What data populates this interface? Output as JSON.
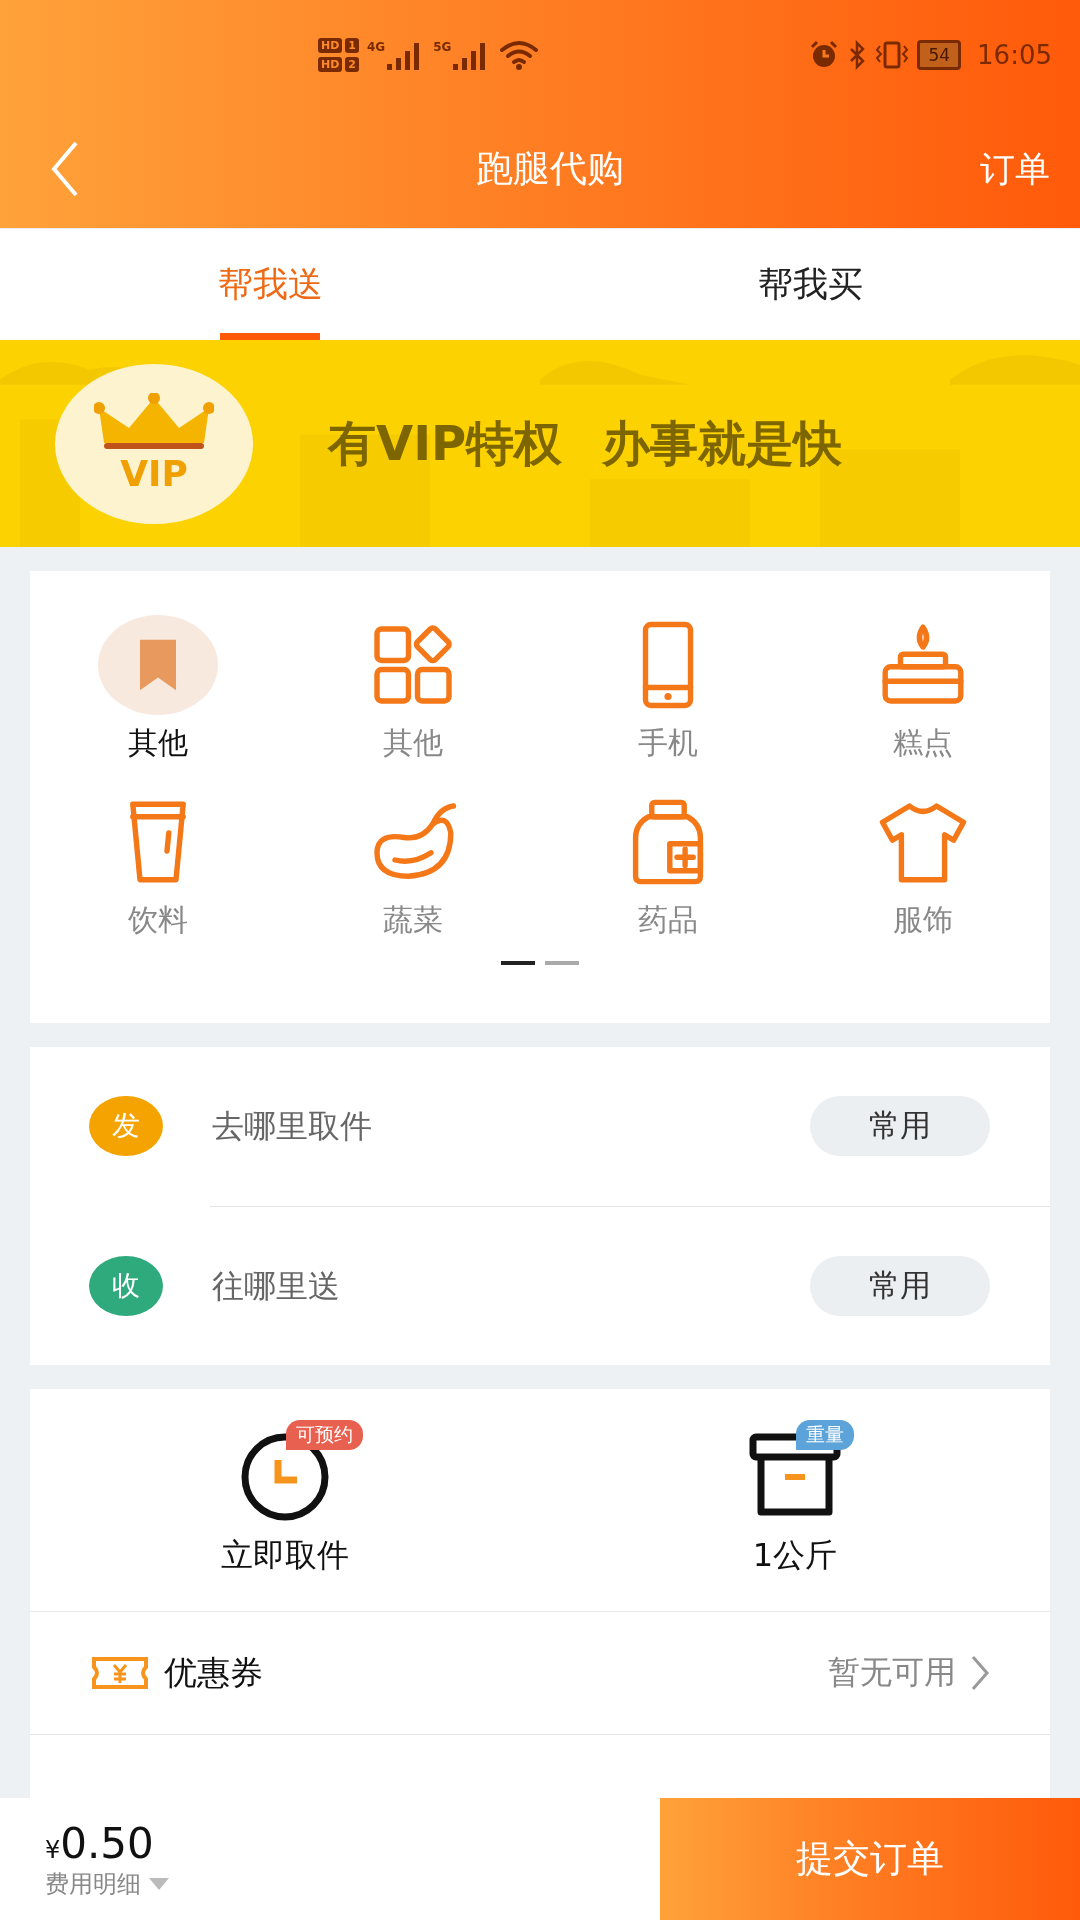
{
  "status_bar": {
    "sims": [
      {
        "label": "HD",
        "slot": "1"
      },
      {
        "label": "HD",
        "slot": "2"
      }
    ],
    "networks": [
      "4G",
      "5G"
    ],
    "battery": "54",
    "time": "16:05"
  },
  "header": {
    "title": "跑腿代购",
    "action": "订单"
  },
  "tabs": [
    {
      "label": "帮我送",
      "selected": true
    },
    {
      "label": "帮我买",
      "selected": false
    }
  ],
  "banner": {
    "badge": "VIP",
    "slogan_1": "有VIP特权",
    "slogan_2": "办事就是快"
  },
  "categories": [
    {
      "label": "其他",
      "selected": true
    },
    {
      "label": "其他",
      "selected": false
    },
    {
      "label": "手机",
      "selected": false
    },
    {
      "label": "糕点",
      "selected": false
    },
    {
      "label": "饮料",
      "selected": false
    },
    {
      "label": "蔬菜",
      "selected": false
    },
    {
      "label": "药品",
      "selected": false
    },
    {
      "label": "服饰",
      "selected": false
    }
  ],
  "pager": [
    {
      "selected": true
    },
    {
      "selected": false
    }
  ],
  "addresses": [
    {
      "tag": "发",
      "color": "#f5a300",
      "placeholder": "去哪里取件",
      "action": "常用"
    },
    {
      "tag": "收",
      "color": "#2eaa7d",
      "placeholder": "往哪里送",
      "action": "常用"
    }
  ],
  "options": [
    {
      "label": "立即取件",
      "badge": "可预约",
      "color": "#e8604f"
    },
    {
      "label": "1公斤",
      "badge": "重量",
      "color": "#5ba3d9"
    }
  ],
  "rows": [
    {
      "label": "优惠券",
      "value": "暂无可用"
    }
  ],
  "footer": {
    "currency": "¥",
    "price": "0.50",
    "details": "费用明细",
    "submit": "提交订单"
  }
}
